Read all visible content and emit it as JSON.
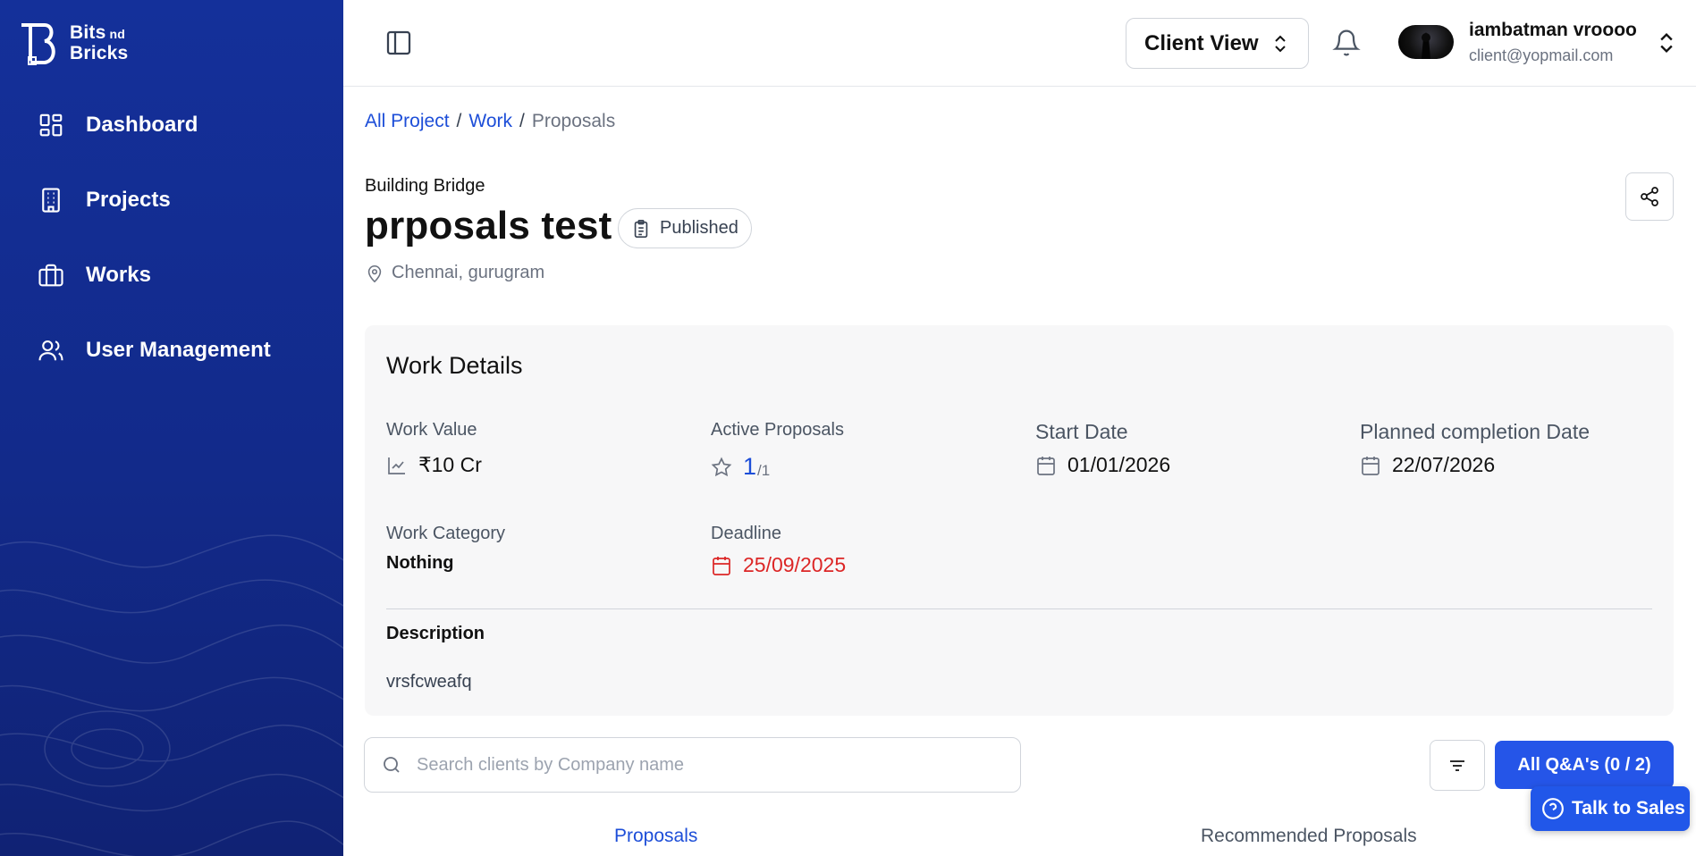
{
  "brand": {
    "line1": "Bits",
    "superscript": "nd",
    "line2": "Bricks",
    "primary_color": "#14309a",
    "accent_color": "#2555e8"
  },
  "sidebar": {
    "items": [
      {
        "label": "Dashboard",
        "icon": "dashboard-grid-icon"
      },
      {
        "label": "Projects",
        "icon": "building-icon"
      },
      {
        "label": "Works",
        "icon": "briefcase-icon"
      },
      {
        "label": "User Management",
        "icon": "users-icon"
      }
    ]
  },
  "topbar": {
    "view_selector": "Client View",
    "user": {
      "name": "iambatman vroooo",
      "email": "client@yopmail.com"
    }
  },
  "breadcrumb": {
    "items": [
      "All Project",
      "Work",
      "Proposals"
    ],
    "separator": "/"
  },
  "header": {
    "project": "Building Bridge",
    "title": "prposals test",
    "status": "Published",
    "location": "Chennai, gurugram"
  },
  "work_details": {
    "title": "Work Details",
    "work_value": {
      "label": "Work Value",
      "value": "₹10 Cr"
    },
    "active_proposals": {
      "label": "Active Proposals",
      "value": "1",
      "total": "/1"
    },
    "start_date": {
      "label": "Start Date",
      "value": "01/01/2026"
    },
    "planned_completion": {
      "label": "Planned completion Date",
      "value": "22/07/2026"
    },
    "work_category": {
      "label": "Work Category",
      "value": "Nothing"
    },
    "deadline": {
      "label": "Deadline",
      "value": "25/09/2025",
      "color": "#dc2626"
    },
    "description": {
      "label": "Description",
      "value": "vrsfcweafq"
    }
  },
  "search": {
    "placeholder": "Search clients by Company name",
    "value": ""
  },
  "actions": {
    "qa_label": "All Q&A's (0 / 2)",
    "talk_label": "Talk to Sales"
  },
  "tabs": [
    {
      "label": "Proposals",
      "active": true
    },
    {
      "label": "Recommended Proposals",
      "active": false
    }
  ]
}
